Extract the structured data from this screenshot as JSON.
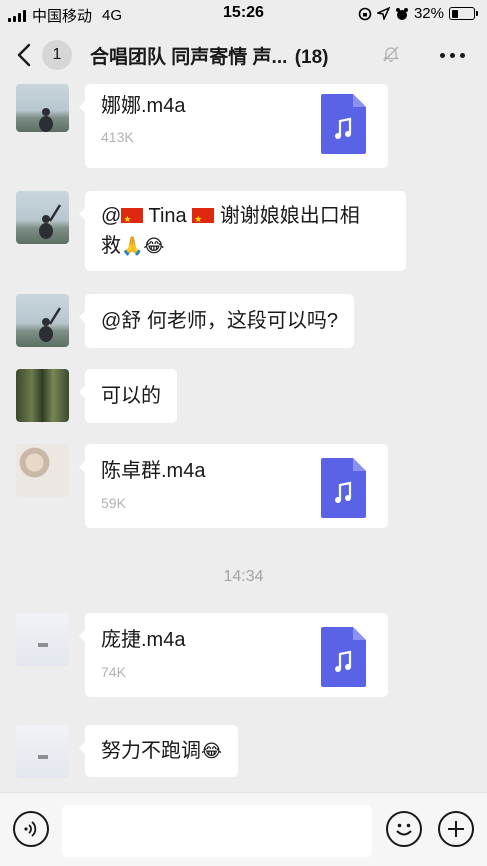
{
  "status_bar": {
    "carrier": "中国移动",
    "network": "4G",
    "time": "15:26",
    "battery": "32%",
    "battery_level": 0.32
  },
  "nav": {
    "back_count": "1",
    "title": "合唱团队 同声寄情 声...",
    "member_count": "(18)"
  },
  "messages": [
    {
      "type": "file",
      "avatar": "lake-avatar",
      "file_name": "娜娜.m4a",
      "file_size": "413K"
    },
    {
      "type": "text",
      "avatar": "lake-avatar",
      "line1_prefix": "@",
      "line1_name": "Tina",
      "line1_suffix": "谢谢娘娘出口相",
      "line2": "救",
      "emoji": "🙏😂"
    },
    {
      "type": "text",
      "avatar": "lake-avatar",
      "text": "@舒 何老师，这段可以吗?"
    },
    {
      "type": "text",
      "avatar": "forest-avatar",
      "text": "可以的"
    },
    {
      "type": "file",
      "avatar": "girl-avatar",
      "file_name": "陈卓群.m4a",
      "file_size": "59K"
    },
    {
      "type": "time",
      "text": "14:34"
    },
    {
      "type": "file",
      "avatar": "snow-avatar",
      "file_name": "庞捷.m4a",
      "file_size": "74K"
    },
    {
      "type": "text",
      "avatar": "snow-avatar",
      "text": "努力不跑调",
      "emoji": "😂"
    }
  ],
  "colors": {
    "background": "#ededed",
    "bubble": "#ffffff",
    "file_icon": "#5a63e6",
    "timestamp": "#a4a4a4"
  }
}
